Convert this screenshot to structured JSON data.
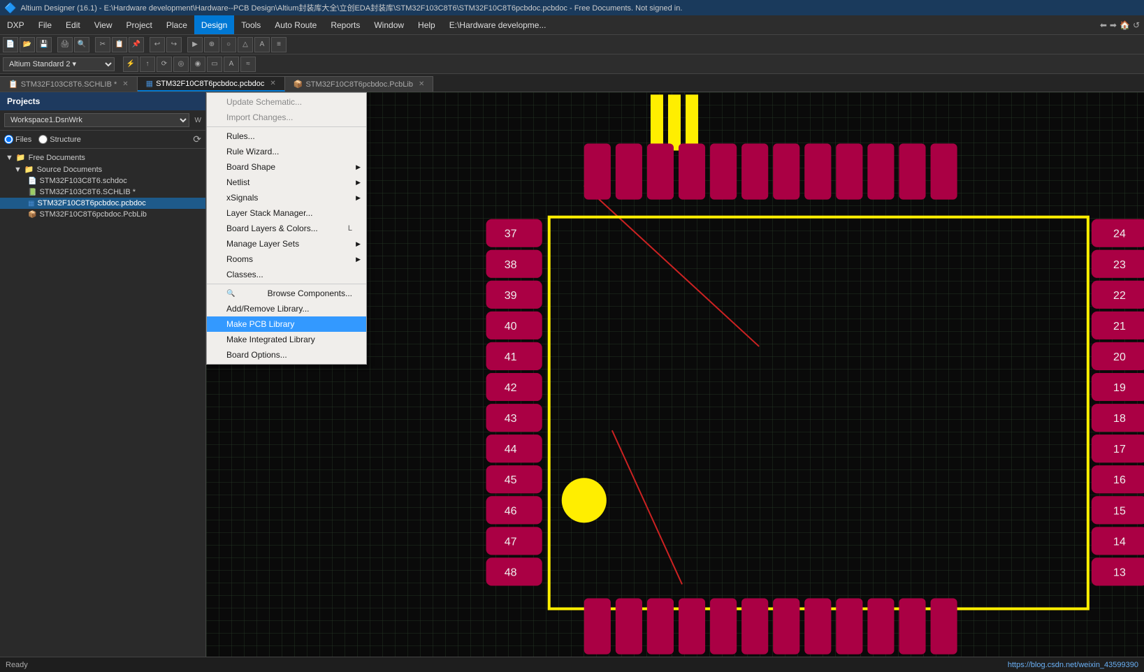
{
  "titlebar": {
    "text": "Altium Designer (16.1) - E:\\Hardware development\\Hardware--PCB Design\\Altium封装库大全\\立创EDA封装库\\STM32F103C8T6\\STM32F10C8T6pcbdoc.pcbdoc - Free Documents. Not signed in."
  },
  "menubar": {
    "items": [
      "DXP",
      "File",
      "Edit",
      "View",
      "Project",
      "Place",
      "Design",
      "Tools",
      "Auto Route",
      "Reports",
      "Window",
      "Help",
      "E:\\Hardware developme..."
    ]
  },
  "tabs": [
    {
      "label": "STM32F103C8T6.SCHLIB",
      "active": false,
      "icon": "sch"
    },
    {
      "label": "STM32F10C8T6pcbdoc.pcbdoc",
      "active": true,
      "icon": "pcb"
    },
    {
      "label": "STM32F10C8T6pcbdoc.PcbLib",
      "active": false,
      "icon": "pcblib"
    }
  ],
  "leftpanel": {
    "title": "Projects",
    "workspace_label": "Workspace1.DsnWrk",
    "radio_files": "Files",
    "radio_structure": "Structure",
    "tree": [
      {
        "label": "Free Documents",
        "type": "folder",
        "indent": 0,
        "expanded": true
      },
      {
        "label": "Source Documents",
        "type": "folder",
        "indent": 1,
        "expanded": true
      },
      {
        "label": "STM32F103C8T6.schdoc",
        "type": "sch",
        "indent": 2
      },
      {
        "label": "STM32F103C8T6.SCHLIB *",
        "type": "schlib",
        "indent": 2
      },
      {
        "label": "STM32F10C8T6pcbdoc.pcbdoc",
        "type": "pcb",
        "indent": 2,
        "selected": true
      },
      {
        "label": "STM32F10C8T6pcbdoc.PcbLib",
        "type": "pcblib",
        "indent": 2
      }
    ]
  },
  "design_menu": {
    "items": [
      {
        "label": "Update Schematic...",
        "key": "",
        "submenu": false,
        "dimmed": false
      },
      {
        "label": "Import Changes...",
        "key": "",
        "submenu": false,
        "dimmed": true
      },
      {
        "label": "sep"
      },
      {
        "label": "Rules...",
        "key": "",
        "submenu": false
      },
      {
        "label": "Rule Wizard...",
        "key": "",
        "submenu": false
      },
      {
        "label": "Board Shape",
        "key": "",
        "submenu": true
      },
      {
        "label": "Netlist",
        "key": "",
        "submenu": true
      },
      {
        "label": "xSignals",
        "key": "",
        "submenu": true
      },
      {
        "label": "Layer Stack Manager...",
        "key": "",
        "submenu": false
      },
      {
        "label": "Board Layers & Colors...",
        "key": "L",
        "submenu": false
      },
      {
        "label": "Manage Layer Sets",
        "key": "",
        "submenu": true
      },
      {
        "label": "Rooms",
        "key": "",
        "submenu": true
      },
      {
        "label": "Classes...",
        "key": "",
        "submenu": false
      },
      {
        "label": "sep"
      },
      {
        "label": "Browse Components...",
        "key": "",
        "submenu": false
      },
      {
        "label": "Add/Remove Library...",
        "key": "",
        "submenu": false
      },
      {
        "label": "Make PCB Library",
        "key": "",
        "submenu": false,
        "highlighted": true
      },
      {
        "label": "Make Integrated Library",
        "key": "",
        "submenu": false
      },
      {
        "label": "Board Options...",
        "key": "",
        "submenu": false
      }
    ]
  },
  "toolbar_combo": "Altium Standard 2 ▾",
  "status_bar": {
    "url": "https://blog.csdn.net/weixin_43599390"
  },
  "pcb_labels": {
    "left_side": [
      "37",
      "38",
      "39",
      "40",
      "41",
      "42",
      "43",
      "44",
      "45",
      "46",
      "47",
      "48"
    ],
    "right_side": [
      "24",
      "23",
      "22",
      "21",
      "20",
      "19",
      "18",
      "17",
      "16",
      "15",
      "14",
      "13"
    ]
  }
}
